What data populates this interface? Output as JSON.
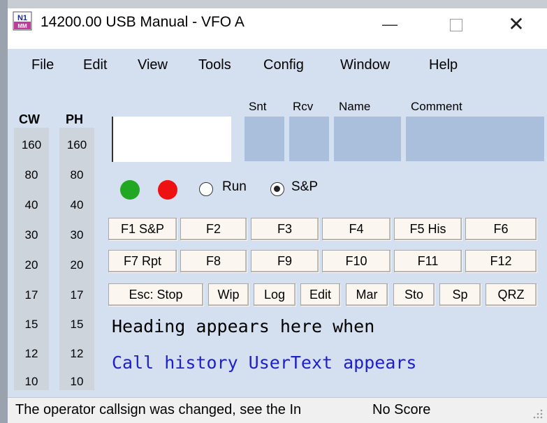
{
  "window": {
    "title": "14200.00 USB Manual - VFO A",
    "icon_name": "n1mm-logo-icon",
    "minimize_glyph": "—",
    "close_glyph": "✕"
  },
  "menu": [
    "File",
    "Edit",
    "View",
    "Tools",
    "Config",
    "Window",
    "Help"
  ],
  "bands": {
    "cw_header": "CW",
    "ph_header": "PH",
    "cw": [
      "160",
      "80",
      "40",
      "30",
      "20",
      "17",
      "15",
      "12",
      "10"
    ],
    "ph": [
      "160",
      "80",
      "40",
      "30",
      "20",
      "17",
      "15",
      "12",
      "10"
    ]
  },
  "entry": {
    "call_value": "",
    "labels": {
      "snt": "Snt",
      "rcv": "Rcv",
      "name": "Name",
      "comment": "Comment"
    }
  },
  "mode": {
    "run_label": "Run",
    "sp_label": "S&P",
    "selected": "S&P",
    "colors": {
      "green_led": "#22a722",
      "red_led": "#ee1111"
    }
  },
  "function_keys": {
    "row1": [
      "F1 S&P",
      "F2",
      "F3",
      "F4",
      "F5 His",
      "F6"
    ],
    "row2": [
      "F7 Rpt",
      "F8",
      "F9",
      "F10",
      "F11",
      "F12"
    ],
    "row3": [
      "Esc: Stop",
      "Wip",
      "Log",
      "Edit",
      "Mar",
      "Sto",
      "Sp",
      "QRZ"
    ]
  },
  "info": {
    "heading_text": "Heading appears here when",
    "history_text": "Call history UserText appears",
    "history_color": "#2020c8"
  },
  "status": {
    "message": "The operator callsign was changed, see the In",
    "score": "No Score"
  }
}
